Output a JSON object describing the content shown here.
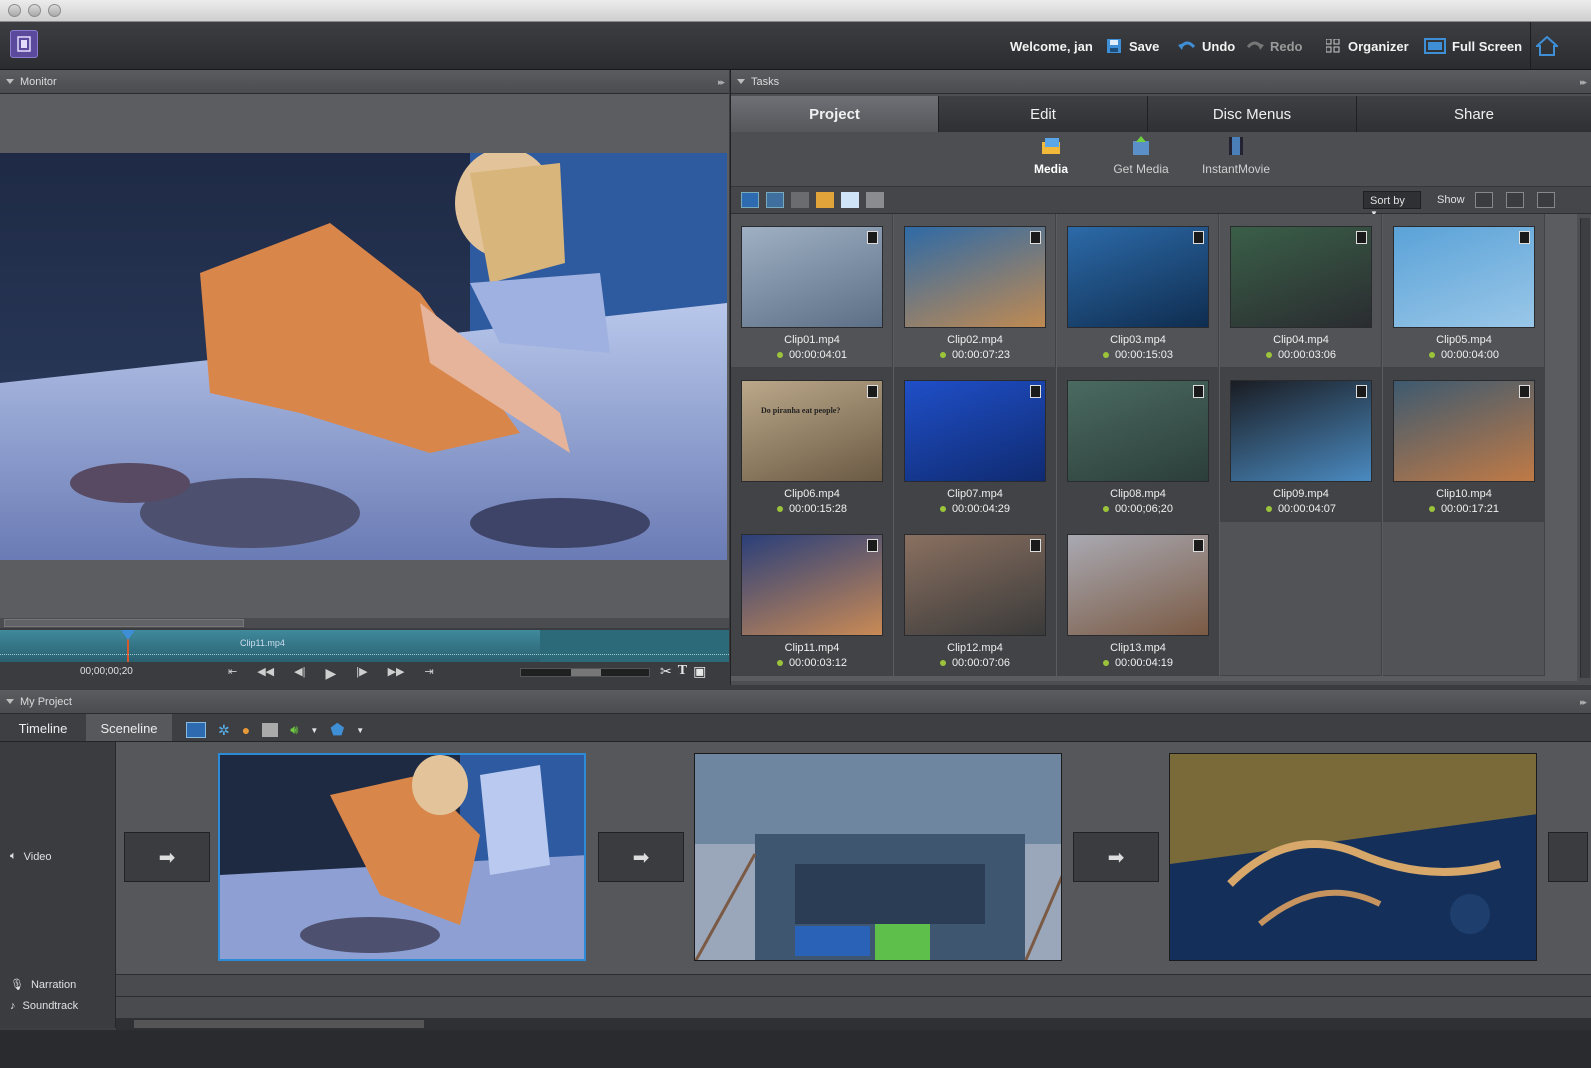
{
  "header": {
    "welcome": "Welcome, jan",
    "save": "Save",
    "undo": "Undo",
    "redo": "Redo",
    "organizer": "Organizer",
    "full_screen": "Full Screen"
  },
  "monitor": {
    "title": "Monitor",
    "clip_label": "Clip11.mp4",
    "timecode": "00;00;00;20"
  },
  "tasks": {
    "title": "Tasks",
    "tabs": [
      "Project",
      "Edit",
      "Disc Menus",
      "Share"
    ],
    "subtabs": [
      "Media",
      "Get Media",
      "InstantMovie"
    ],
    "sort_by": "Sort by",
    "show": "Show",
    "clips": [
      {
        "name": "Clip01.mp4",
        "duration": "00:00:04:01"
      },
      {
        "name": "Clip02.mp4",
        "duration": "00:00:07:23"
      },
      {
        "name": "Clip03.mp4",
        "duration": "00:00:15:03"
      },
      {
        "name": "Clip04.mp4",
        "duration": "00:00:03:06"
      },
      {
        "name": "Clip05.mp4",
        "duration": "00:00:04:00"
      },
      {
        "name": "Clip06.mp4",
        "duration": "00:00:15:28"
      },
      {
        "name": "Clip07.mp4",
        "duration": "00:00:04:29"
      },
      {
        "name": "Clip08.mp4",
        "duration": "00:00;06;20"
      },
      {
        "name": "Clip09.mp4",
        "duration": "00:00:04:07"
      },
      {
        "name": "Clip10.mp4",
        "duration": "00:00:17:21"
      },
      {
        "name": "Clip11.mp4",
        "duration": "00:00:03:12"
      },
      {
        "name": "Clip12.mp4",
        "duration": "00:00:07:06"
      },
      {
        "name": "Clip13.mp4",
        "duration": "00:00:04:19"
      }
    ],
    "sign_text": "Do piranha eat people?"
  },
  "project": {
    "title": "My Project",
    "tabs": [
      "Timeline",
      "Sceneline"
    ],
    "tracks": [
      "Video",
      "Narration",
      "Soundtrack"
    ]
  }
}
